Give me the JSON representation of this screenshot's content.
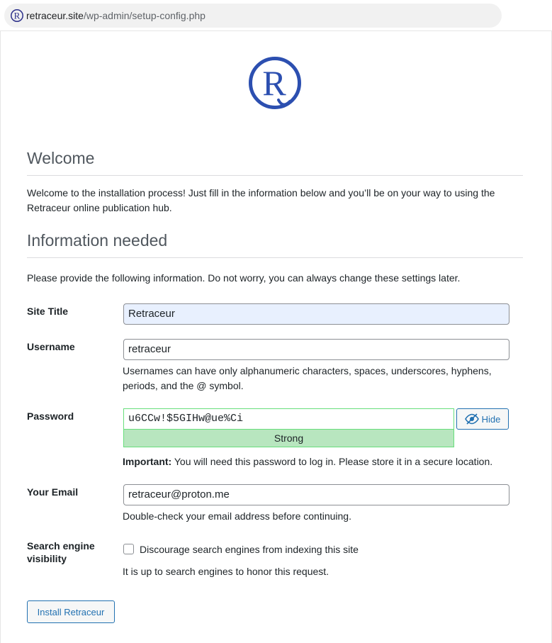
{
  "browser": {
    "url_host": "retraceur.site",
    "url_path": "/wp-admin/setup-config.php"
  },
  "welcome": {
    "heading": "Welcome",
    "text": "Welcome to the installation process! Just fill in the information below and you’ll be on your way to using the Retraceur online publication hub."
  },
  "info": {
    "heading": "Information needed",
    "text": "Please provide the following information. Do not worry, you can always change these settings later."
  },
  "form": {
    "site_title": {
      "label": "Site Title",
      "value": "Retraceur"
    },
    "username": {
      "label": "Username",
      "value": "retraceur",
      "description": "Usernames can have only alphanumeric characters, spaces, underscores, hyphens, periods, and the @ symbol."
    },
    "password": {
      "label": "Password",
      "value": "u6CCw!$5GIHw@ue%Ci",
      "hide_label": "Hide",
      "strength": "Strong",
      "important_prefix": "Important:",
      "important_text": " You will need this password to log in. Please store it in a secure location."
    },
    "email": {
      "label": "Your Email",
      "value": "retraceur@proton.me",
      "description": "Double-check your email address before continuing."
    },
    "search": {
      "label": "Search engine visibility",
      "checkbox_label": "Discourage search engines from indexing this site",
      "checked": false,
      "description": "It is up to search engines to honor this request."
    }
  },
  "install_button": "Install Retraceur",
  "colors": {
    "brand": "#2c4fb0",
    "link": "#2271b1",
    "strength_bg": "#b8e6bf"
  },
  "icons": [
    "retraceur-logo",
    "eye-slash-icon"
  ]
}
